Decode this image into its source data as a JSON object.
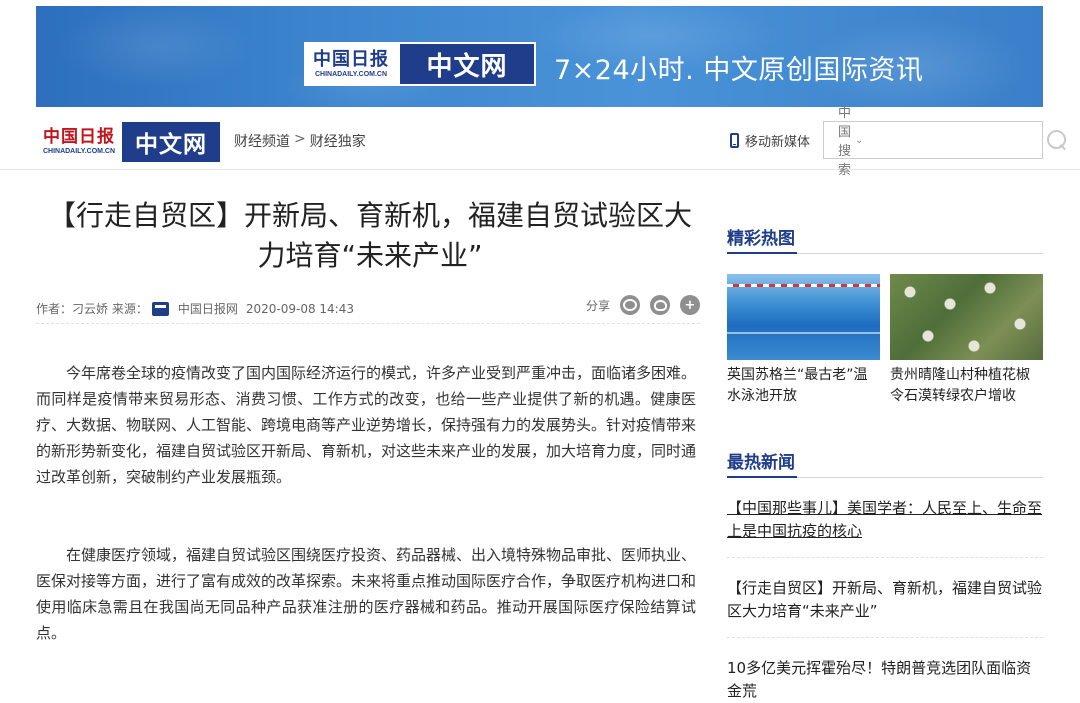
{
  "banner": {
    "logo_cn": "中国日报",
    "logo_en": "CHINADAILY.COM.CN",
    "logo_zw": "中文网",
    "slogan": "7×24小时. 中文原创国际资讯"
  },
  "nav": {
    "logo_cn": "中国日报",
    "logo_en": "CHINADAILY.COM.CN",
    "logo_zw": "中文网",
    "breadcrumb": [
      "财经频道",
      ">",
      "财经独家"
    ],
    "mobile_label": "移动新媒体",
    "search_select": "中国搜索",
    "search_placeholder": ""
  },
  "article": {
    "title": "【行走自贸区】开新局、育新机，福建自贸试验区大力培育“未来产业”",
    "author_label": "作者：刁云娇 来源：",
    "source": "中国日报网",
    "datetime": "2020-09-08 14:43",
    "share_label": "分享",
    "paragraphs": [
      "今年席卷全球的疫情改变了国内国际经济运行的模式，许多产业受到严重冲击，面临诸多困难。而同样是疫情带来贸易形态、消费习惯、工作方式的改变，也给一些产业提供了新的机遇。健康医疗、大数据、物联网、人工智能、跨境电商等产业逆势增长，保持强有力的发展势头。针对疫情带来的新形势新变化，福建自贸试验区开新局、育新机，对这些未来产业的发展，加大培育力度，同时通过改革创新，突破制约产业发展瓶颈。",
      "在健康医疗领域，福建自贸试验区围绕医疗投资、药品器械、出入境特殊物品审批、医师执业、医保对接等方面，进行了富有成效的改革探索。未来将重点推动国际医疗合作，争取医疗机构进口和使用临床急需且在我国尚无同品种产品获准注册的医疗器械和药品。推动开展国际医疗保险结算试点。"
    ]
  },
  "sidebar": {
    "photos_heading": "精彩热图",
    "photos": [
      {
        "caption": "英国苏格兰“最古老”温水泳池开放"
      },
      {
        "caption": "贵州晴隆山村种植花椒令石漠转绿农户增收"
      }
    ],
    "news_heading": "最热新闻",
    "news": [
      "【中国那些事儿】美国学者：人民至上、生命至上是中国抗疫的核心",
      "【行走自贸区】开新局、育新机，福建自贸试验区大力培育“未来产业”",
      "10多亿美元挥霍殆尽！特朗普竞选团队面临资金荒"
    ]
  }
}
